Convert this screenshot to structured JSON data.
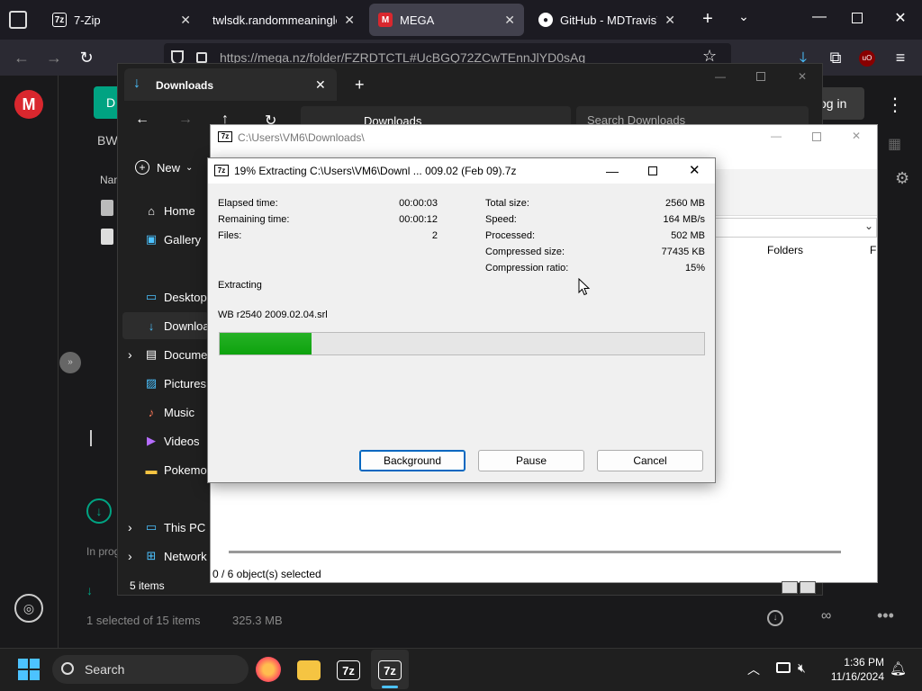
{
  "browser": {
    "tabs": [
      {
        "label": "7-Zip",
        "fav": "7z"
      },
      {
        "label": "twlsdk.randommeaningles",
        "fav": ""
      },
      {
        "label": "MEGA",
        "fav": "M"
      },
      {
        "label": "GitHub - MDTravisYT/i",
        "fav": "●"
      }
    ],
    "url": "https://mega.nz/folder/FZRDTCTL#UcBGQ72ZCwTEnnJlYD0sAg"
  },
  "mega": {
    "logo": "M",
    "header_partial": "BW",
    "col_partial": "Nam",
    "login_label": "og in",
    "left_btn": "D",
    "transfer_status": "In prog",
    "footer_selection": "1 selected of 15 items",
    "footer_size": "325.3 MB"
  },
  "explorer": {
    "tab_title": "Downloads",
    "breadcrumb": "Downloads",
    "search_placeholder": "Search Downloads",
    "new_label": "New",
    "items": [
      {
        "label": "Home",
        "icon": "⌂"
      },
      {
        "label": "Gallery",
        "icon": "▣"
      },
      {
        "label": "Desktop",
        "icon": "▭"
      },
      {
        "label": "Downloa",
        "icon": "↓"
      },
      {
        "label": "Docume",
        "icon": "▤"
      },
      {
        "label": "Pictures",
        "icon": "▨"
      },
      {
        "label": "Music",
        "icon": "♪"
      },
      {
        "label": "Videos",
        "icon": "▶"
      },
      {
        "label": "Pokemo",
        "icon": "▬"
      },
      {
        "label": "This PC",
        "icon": "▭"
      },
      {
        "label": "Network",
        "icon": "⊞"
      }
    ],
    "status": "5 items"
  },
  "filemanager": {
    "title": "C:\\Users\\VM6\\Downloads\\",
    "col_folders": "Folders",
    "col_f": "F",
    "status": "0 / 6 object(s) selected"
  },
  "dialog": {
    "title": "19% Extracting C:\\Users\\VM6\\Downl ... 009.02 (Feb 09).7z",
    "left": [
      {
        "label": "Elapsed time:",
        "value": "00:00:03"
      },
      {
        "label": "Remaining time:",
        "value": "00:00:12"
      },
      {
        "label": "Files:",
        "value": "2"
      }
    ],
    "right": [
      {
        "label": "Total size:",
        "value": "2560 MB"
      },
      {
        "label": "Speed:",
        "value": "164 MB/s"
      },
      {
        "label": "Processed:",
        "value": "502 MB"
      },
      {
        "label": "Compressed size:",
        "value": "77435 KB"
      },
      {
        "label": "Compression ratio:",
        "value": "15%"
      }
    ],
    "action": "Extracting",
    "current_file": "WB r2540 2009.02.04.srl",
    "progress": 0.19,
    "buttons": {
      "background": "Background",
      "pause": "Pause",
      "cancel": "Cancel"
    }
  },
  "taskbar": {
    "search": "Search",
    "time": "1:36 PM",
    "date": "11/16/2024"
  },
  "colors": {
    "accent": "#0067c0",
    "progress": "#16a816",
    "mega_red": "#d9272e"
  }
}
